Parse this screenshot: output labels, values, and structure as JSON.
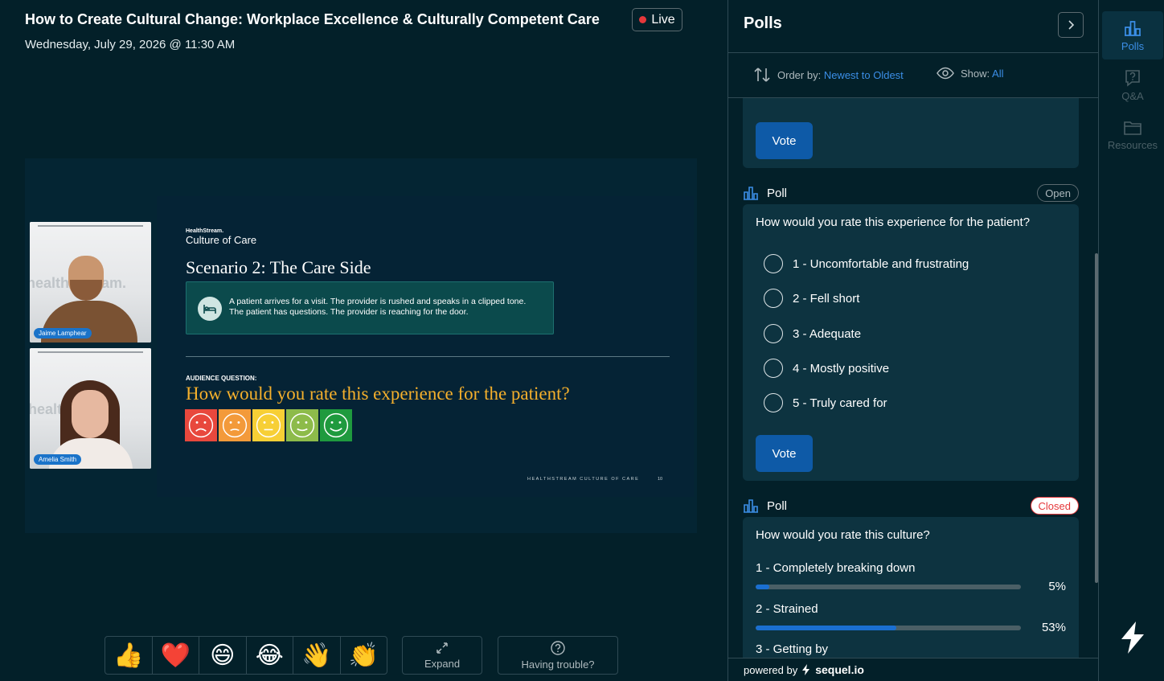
{
  "event": {
    "title": "How to Create Cultural Change: Workplace Excellence & Culturally Competent Care",
    "live_label": "Live",
    "date": "Wednesday, July 29, 2026 @ 11:30 AM"
  },
  "participants": [
    {
      "name": "Jaime Lamphear"
    },
    {
      "name": "Amelia Smith"
    }
  ],
  "slide": {
    "brand_small": "HealthStream.",
    "brand": "Culture of Care",
    "scenario_title": "Scenario 2: The Care Side",
    "scenario_text": "A patient arrives for a visit. The provider is rushed and speaks in a clipped tone. The patient has questions. The provider is reaching for the door.",
    "audience_label": "AUDIENCE QUESTION:",
    "audience_question": "How would you rate this experience for the patient?",
    "footer": "HEALTHSTREAM CULTURE OF CARE",
    "page_number": "10",
    "face_colors": [
      "#e8483d",
      "#f39a3a",
      "#f7cf35",
      "#8dbb4a",
      "#1f9a3e"
    ]
  },
  "controls": {
    "reactions": [
      "👍",
      "❤️",
      "😄",
      "😂",
      "👋",
      "👏"
    ],
    "expand_label": "Expand",
    "trouble_label": "Having trouble?"
  },
  "polls_panel": {
    "title": "Polls",
    "order_label": "Order by:",
    "order_value": "Newest to Oldest",
    "show_label": "Show:",
    "show_value": "All",
    "top_vote_label": "Vote",
    "open_poll": {
      "type_label": "Poll",
      "status": "Open",
      "question": "How would you rate this experience for the patient?",
      "options": [
        "1 - Uncomfortable and frustrating",
        "2 - Fell short",
        "3 - Adequate",
        "4 - Mostly positive",
        "5 - Truly cared for"
      ],
      "vote_label": "Vote"
    },
    "closed_poll": {
      "type_label": "Poll",
      "status": "Closed",
      "question": "How would you rate this culture?",
      "results": [
        {
          "label": "1 - Completely breaking down",
          "percent": 5,
          "percent_label": "5%"
        },
        {
          "label": "2 - Strained",
          "percent": 53,
          "percent_label": "53%"
        },
        {
          "label": "3 - Getting by"
        }
      ]
    },
    "powered_prefix": "powered by",
    "powered_brand": "sequel.io"
  },
  "rail": {
    "items": [
      {
        "label": "Polls",
        "icon": "polls-icon",
        "active": true
      },
      {
        "label": "Q&A",
        "icon": "qa-icon",
        "active": false
      },
      {
        "label": "Resources",
        "icon": "folder-icon",
        "active": false
      }
    ]
  },
  "colors": {
    "accent": "#3b8ee6",
    "button": "#0e5aa7",
    "live": "#e5383b",
    "question_gold": "#f5b02c"
  }
}
